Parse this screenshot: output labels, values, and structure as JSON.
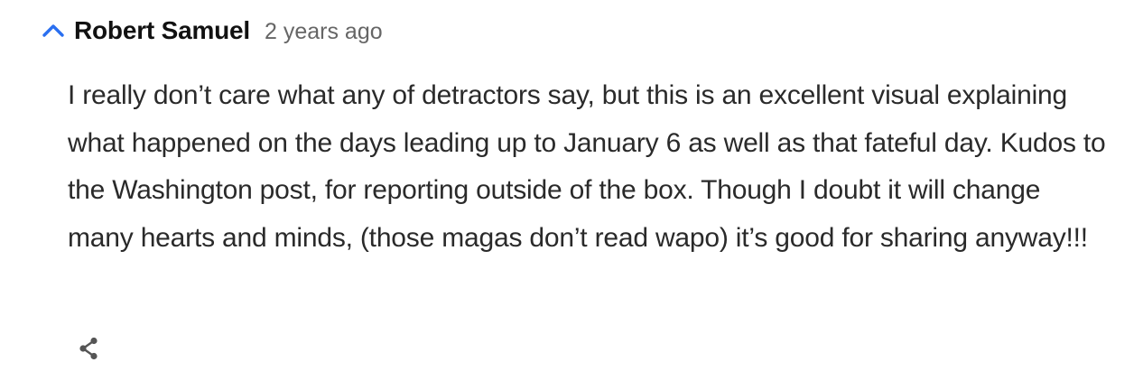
{
  "comment": {
    "author": "Robert Samuel",
    "timestamp": "2 years ago",
    "text": "I really don’t care what any of detractors say, but this is an excellent visual explaining what happened on the days leading up to January 6 as well as that fateful day. Kudos to the Washington post, for reporting outside of the box. Though I doubt it will change many hearts and minds, (those magas don’t read wapo) it’s good for sharing anyway!!!",
    "collapse_icon": "chevron-up-icon",
    "share_icon": "share-icon"
  },
  "colors": {
    "accent": "#2a6ff0",
    "author": "#111111",
    "timestamp": "#666666",
    "body_text": "#2a2a2a",
    "icon": "#555555"
  }
}
